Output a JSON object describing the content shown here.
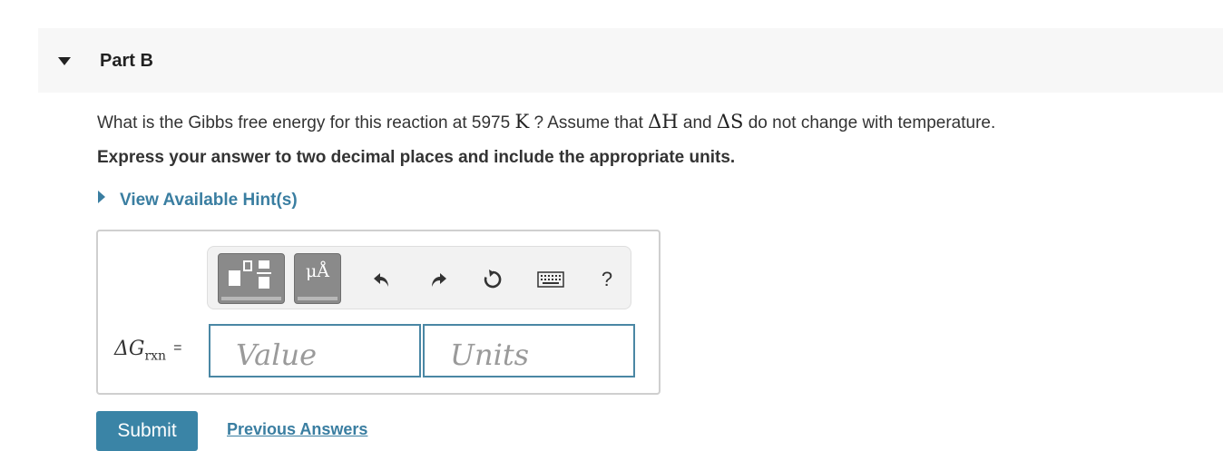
{
  "part": {
    "title": "Part B"
  },
  "question": {
    "text_before": "What is the Gibbs free energy for this reaction at 5975",
    "temp_unit": "K",
    "text_mid": "? Assume that",
    "dh": "ΔH",
    "and": "and",
    "ds": "ΔS",
    "text_after": "do not change with temperature."
  },
  "instruction": "Express your answer to two decimal places and include the appropriate units.",
  "hint": {
    "label": "View Available Hint(s)"
  },
  "toolbar": {
    "units_label": "μÅ",
    "help_label": "?",
    "icons": [
      "templates-icon",
      "units-icon",
      "undo-icon",
      "redo-icon",
      "reset-icon",
      "keyboard-icon",
      "help-icon"
    ]
  },
  "answer": {
    "label_delta": "ΔG",
    "label_sub": "rxn",
    "equals": "=",
    "value_placeholder": "Value",
    "units_placeholder": "Units"
  },
  "actions": {
    "submit_label": "Submit",
    "previous_answers_label": "Previous Answers"
  },
  "colors": {
    "accent": "#3a84a6",
    "link": "#3a7ea1",
    "header_bg": "#f7f7f7"
  }
}
